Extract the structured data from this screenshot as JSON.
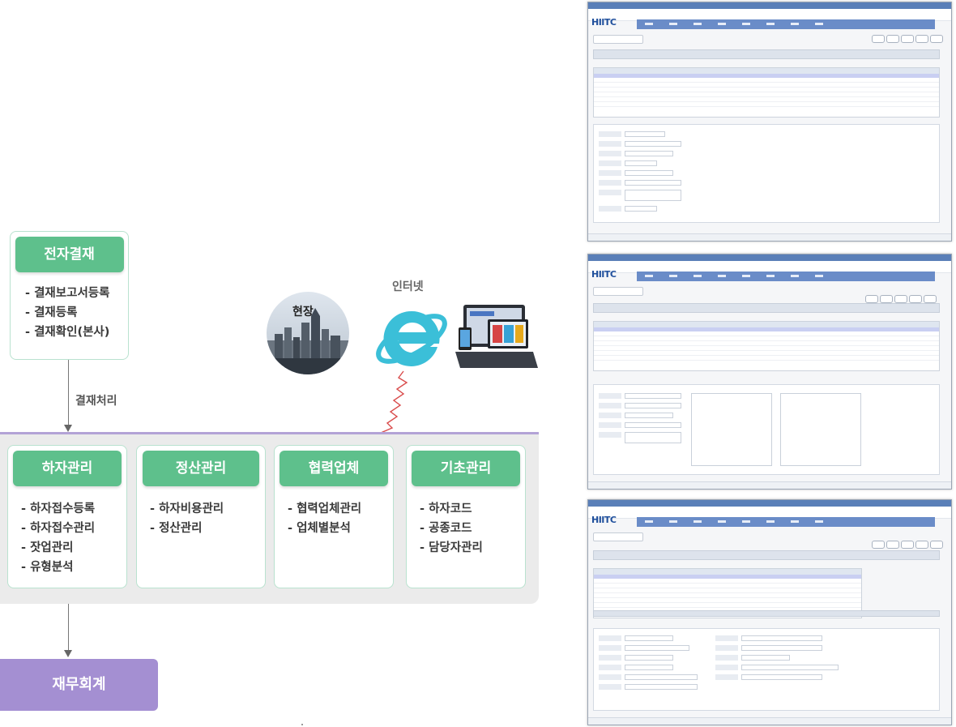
{
  "approval": {
    "title": "전자결재",
    "items": [
      "결재보고서등록",
      "결재등록",
      "결재확인(본사)"
    ]
  },
  "process_label": "결재처리",
  "site_label": "현장",
  "internet_label": "인터넷",
  "modules": [
    {
      "title": "하자관리",
      "items": [
        "하자접수등록",
        "하자접수관리",
        "잣업관리",
        "유형분석"
      ]
    },
    {
      "title": "정산관리",
      "items": [
        "하자비용관리",
        "정산관리"
      ]
    },
    {
      "title": "협력업체",
      "items": [
        "협력업체관리",
        "업체별분석"
      ]
    },
    {
      "title": "기초관리",
      "items": [
        "하자코드",
        "공종코드",
        "담당자관리"
      ]
    }
  ],
  "finance": "재무회계",
  "screens": {
    "logo_main": "HIITC",
    "count": 3
  },
  "colors": {
    "green": "#5ec08c",
    "purple": "#a48fd2",
    "ie_blue": "#3bbfd8"
  }
}
